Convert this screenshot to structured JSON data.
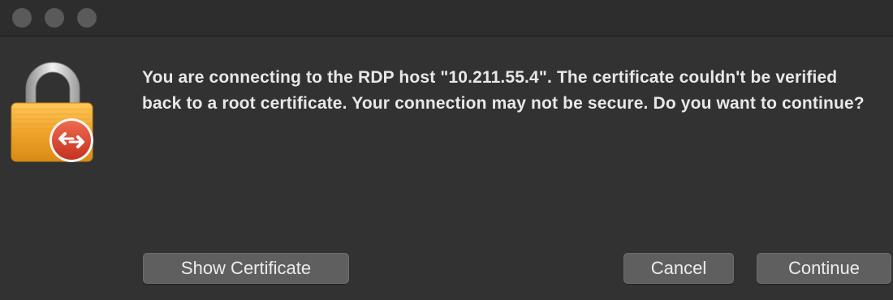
{
  "dialog": {
    "message": "You are connecting to the RDP host \"10.211.55.4\". The certificate couldn't be verified back to a root certificate. Your connection may not be secure. Do you want to continue?"
  },
  "buttons": {
    "show_certificate": "Show Certificate",
    "cancel": "Cancel",
    "continue": "Continue"
  },
  "colors": {
    "window_bg": "#323232",
    "button_bg": "#5f5f5f",
    "lock_gold": "#f0a429",
    "badge_red": "#d9432f"
  },
  "icons": {
    "window_close": "close-icon",
    "window_minimize": "minimize-icon",
    "window_zoom": "zoom-icon",
    "dialog_icon": "padlock-icon",
    "badge": "remote-desktop-icon"
  }
}
